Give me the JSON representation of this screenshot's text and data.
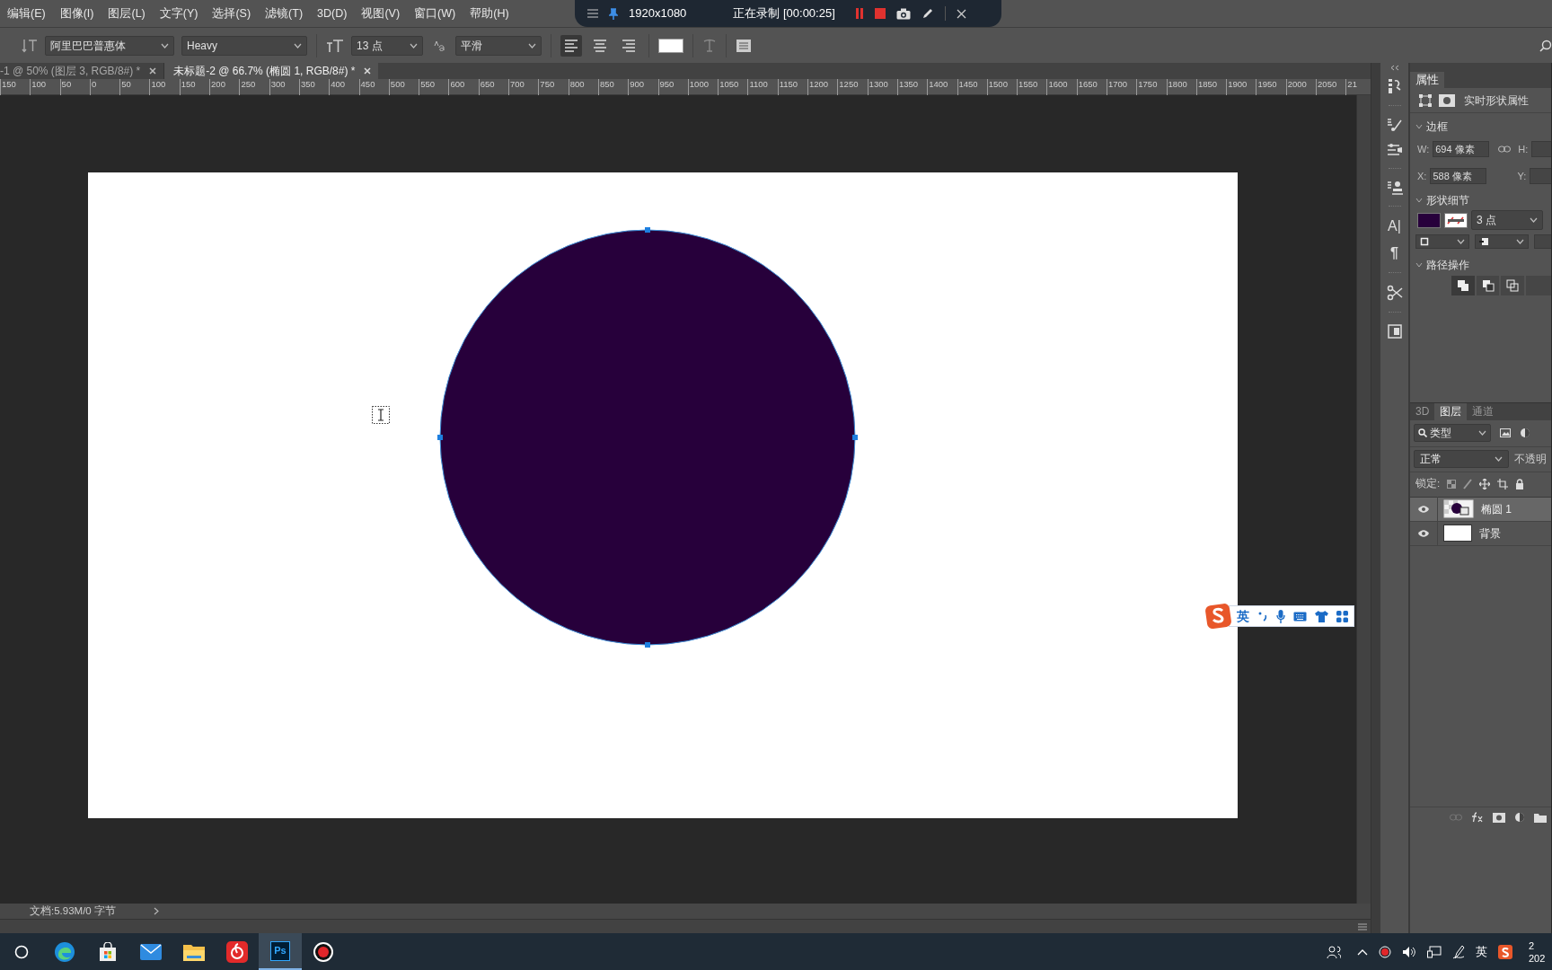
{
  "menu": [
    "编辑(E)",
    "图像(I)",
    "图层(L)",
    "文字(Y)",
    "选择(S)",
    "滤镜(T)",
    "3D(D)",
    "视图(V)",
    "窗口(W)",
    "帮助(H)"
  ],
  "recorder": {
    "resolution": "1920x1080",
    "status": "正在录制 [00:00:25]"
  },
  "options": {
    "font_family": "阿里巴巴普惠体",
    "font_style": "Heavy",
    "font_size": "13 点",
    "antialias": "平滑",
    "align": [
      {
        "selected": true
      },
      {
        "selected": false
      },
      {
        "selected": false
      }
    ]
  },
  "doc_tabs": [
    {
      "label": "-1 @ 50% (图层 3, RGB/8#) *",
      "selected": false
    },
    {
      "label": "未标题-2 @ 66.7% (椭圆 1, RGB/8#) *",
      "selected": true
    }
  ],
  "ruler": [
    "150",
    "100",
    "50",
    "0",
    "50",
    "100",
    "150",
    "200",
    "250",
    "300",
    "350",
    "400",
    "450",
    "500",
    "550",
    "600",
    "650",
    "700",
    "750",
    "800",
    "850",
    "900",
    "950",
    "1000",
    "1050",
    "1100",
    "1150",
    "1200",
    "1250",
    "1300",
    "1350",
    "1400",
    "1450",
    "1500",
    "1550",
    "1600",
    "1650",
    "1700",
    "1750",
    "1800",
    "1850",
    "1900",
    "1950",
    "2000",
    "2050",
    "21"
  ],
  "ime": {
    "mode": "英"
  },
  "status_bar": {
    "doc_info": "文档:5.93M/0 字节"
  },
  "panel_glyphs": {
    "character": "A|",
    "paragraph": "¶"
  },
  "properties": {
    "tab": "属性",
    "title": "实时形状属性",
    "sections": [
      "边框",
      "形状细节",
      "路径操作"
    ],
    "w_label": "W:",
    "w_value": "694 像素",
    "h_label": "H:",
    "x_label": "X:",
    "x_value": "588 像素",
    "y_label": "Y:",
    "stroke_width": "3 点"
  },
  "layers_panel": {
    "tabs": [
      {
        "label": "3D",
        "selected": false
      },
      {
        "label": "图层",
        "selected": true
      },
      {
        "label": "通道",
        "selected": false
      }
    ],
    "filter": "类型",
    "blend": "正常",
    "opacity_label": "不透明",
    "lock_label": "锁定:",
    "layers": [
      {
        "name": "椭圆 1",
        "kind": "shape",
        "selected": true,
        "visible": true
      },
      {
        "name": "背景",
        "kind": "fill",
        "selected": false,
        "visible": true
      }
    ]
  },
  "taskbar": {
    "ps_label": "Ps",
    "tray_ime": "英",
    "clock": [
      "2",
      "202"
    ]
  }
}
